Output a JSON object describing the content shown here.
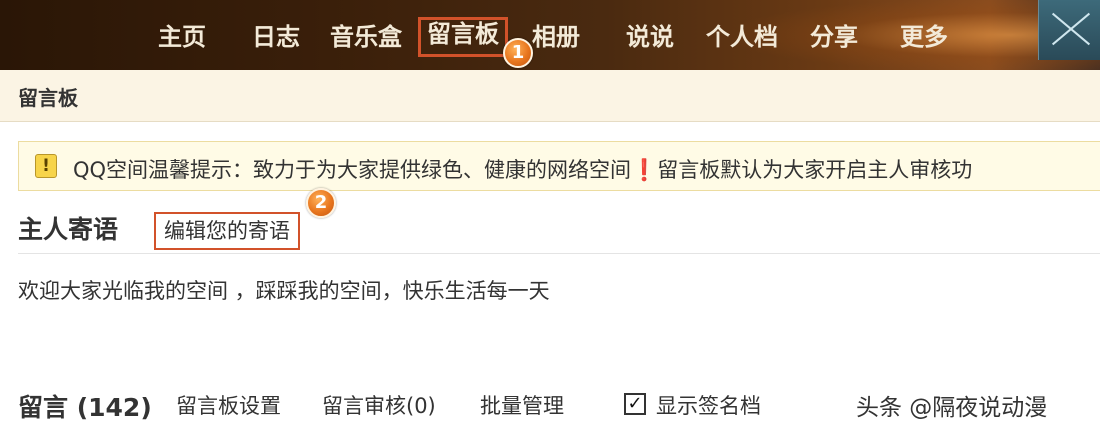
{
  "nav": {
    "items": [
      {
        "label": "主页"
      },
      {
        "label": "日志"
      },
      {
        "label": "音乐盒"
      },
      {
        "label": "留言板"
      },
      {
        "label": "相册"
      },
      {
        "label": "说说"
      },
      {
        "label": "个人档"
      },
      {
        "label": "分享"
      },
      {
        "label": "更多"
      }
    ],
    "active_index": 3,
    "step_badge": "1"
  },
  "subheader": {
    "title": "留言板"
  },
  "tip": {
    "icon": "exclamation-notice-icon",
    "text": "QQ空间温馨提示：致力于为大家提供绿色、健康的网络空间❗留言板默认为大家开启主人审核功"
  },
  "host": {
    "title": "主人寄语",
    "edit_link": "编辑您的寄语",
    "step_badge": "2",
    "message": "欢迎大家光临我的空间 ，踩踩我的空间，快乐生活每一天"
  },
  "comments": {
    "title": "留言 (142)",
    "settings_link": "留言板设置",
    "review_link": "留言审核(0)",
    "batch_link": "批量管理",
    "show_signature": {
      "label": "显示签名档",
      "checked": true,
      "mark": "✓"
    }
  },
  "watermark": "头条 @隔夜说动漫",
  "colors": {
    "highlight_border": "#d2522a",
    "badge_orange": "#e8761e",
    "nav_text": "#f3ead8",
    "tip_background": "#fffbe6"
  }
}
